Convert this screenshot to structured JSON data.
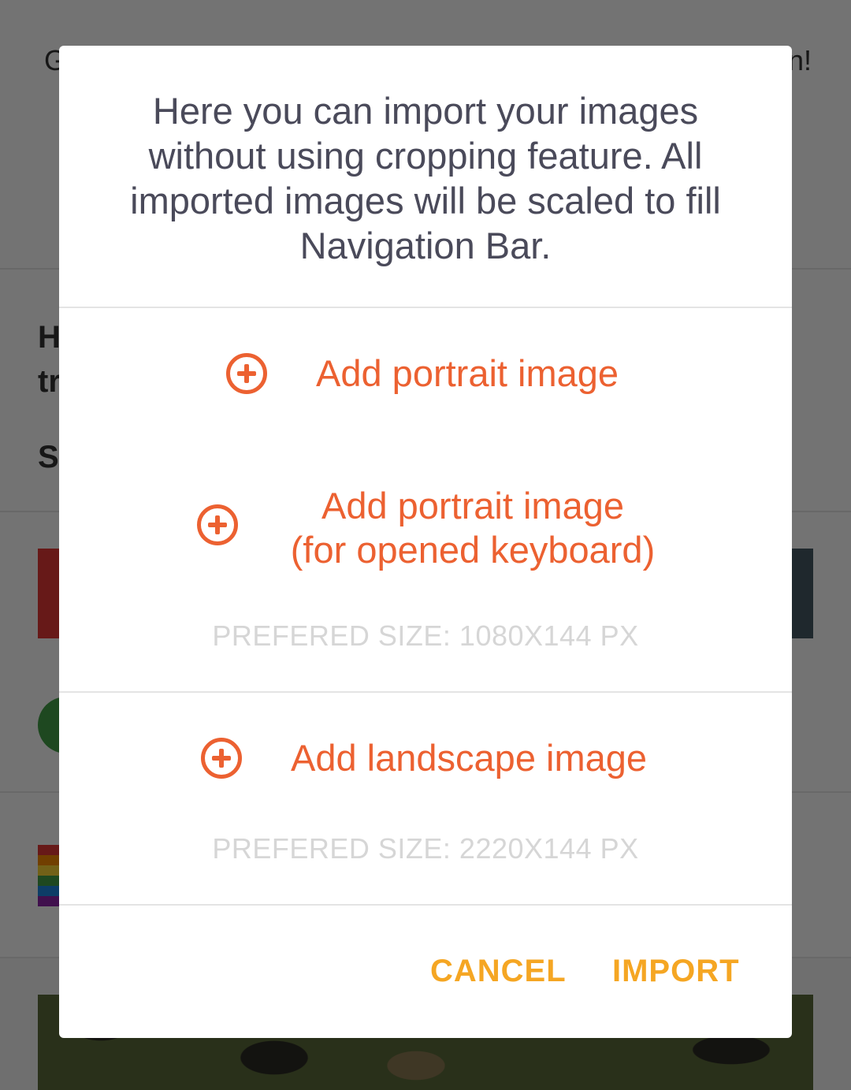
{
  "background": {
    "top_left_char": "G",
    "top_right_char": "n!",
    "section_heading_line1": "H",
    "section_heading_line2": "tr",
    "section_subheading": "S"
  },
  "dialog": {
    "message": "Here you can import your images without using cropping feature. All imported images will be scaled to fill Navigation Bar.",
    "portrait": {
      "label": "Add portrait image",
      "icon": "plus-circle-icon"
    },
    "portrait_keyboard": {
      "label_line1": "Add portrait image",
      "label_line2": "(for opened keyboard)",
      "icon": "plus-circle-icon",
      "size_hint": "PREFERED SIZE: 1080X144 PX"
    },
    "landscape": {
      "label": "Add landscape image",
      "icon": "plus-circle-icon",
      "size_hint": "PREFERED SIZE: 2220X144 PX"
    },
    "buttons": {
      "cancel": "CANCEL",
      "import": "IMPORT"
    }
  },
  "colors": {
    "accent": "#ec6131",
    "button": "#f5a623",
    "message_text": "#4a4a5a",
    "hint_text": "#d6d6d6"
  }
}
